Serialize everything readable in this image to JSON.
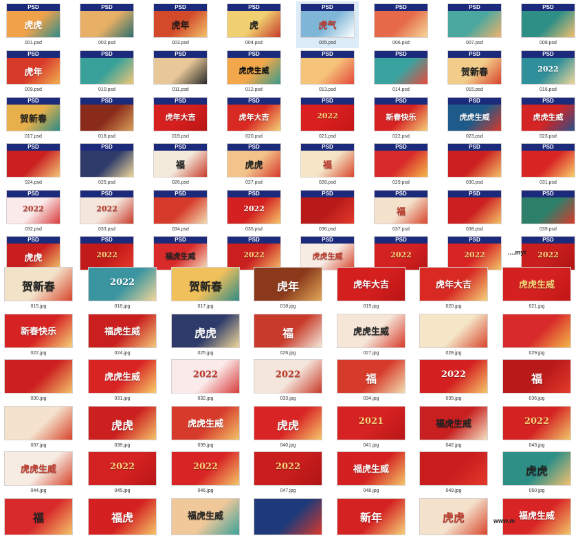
{
  "badge_label": "PSD",
  "watermarks": [
    "….myt",
    "www.m"
  ],
  "top_section": [
    {
      "cap": "001.psd",
      "title": "虎虎",
      "c": "#f0a24a",
      "c2": "#2f8c8c",
      "tc": "#ffffff"
    },
    {
      "cap": "002.psd",
      "title": "",
      "c": "#e8b066",
      "c2": "#2b6e6e",
      "tc": "#ffffff"
    },
    {
      "cap": "003.psd",
      "title": "虎年",
      "c": "#d24a2a",
      "c2": "#f2c36a",
      "tc": "#2b1a1a"
    },
    {
      "cap": "004.psd",
      "title": "虎",
      "c": "#f0d070",
      "c2": "#c73b2a",
      "tc": "#222222"
    },
    {
      "cap": "005.psd",
      "title": "虎气",
      "c": "#7fb6d8",
      "c2": "#ffffff",
      "tc": "#c0392b"
    },
    {
      "cap": "006.psd",
      "title": "",
      "c": "#e66a4a",
      "c2": "#f5d89a",
      "tc": "#ffffff"
    },
    {
      "cap": "007.psd",
      "title": "",
      "c": "#4aa8a0",
      "c2": "#f2b26a",
      "tc": "#ffffff"
    },
    {
      "cap": "008.psd",
      "title": "",
      "c": "#2e8f86",
      "c2": "#f3c070",
      "tc": "#ffffff"
    },
    {
      "cap": "009.psd",
      "title": "虎年",
      "c": "#d83a2a",
      "c2": "#f2b050",
      "tc": "#ffffff"
    },
    {
      "cap": "010.psd",
      "title": "",
      "c": "#3aa19a",
      "c2": "#f0c777",
      "tc": "#ffffff"
    },
    {
      "cap": "011.psd",
      "title": "",
      "c": "#e8c898",
      "c2": "#2a2a2a",
      "tc": "#111111"
    },
    {
      "cap": "012.psd",
      "title": "虎虎生威",
      "c": "#f2a84a",
      "c2": "#3a9a8a",
      "tc": "#111111"
    },
    {
      "cap": "013.psd",
      "title": "",
      "c": "#f6c37a",
      "c2": "#e44a3a",
      "tc": "#ffffff"
    },
    {
      "cap": "014.psd",
      "title": "",
      "c": "#3aa3a0",
      "c2": "#e64a3a",
      "tc": "#ffffff"
    },
    {
      "cap": "015.psd",
      "title": "贺新春",
      "c": "#f2cc8a",
      "c2": "#d8452c",
      "tc": "#222222"
    },
    {
      "cap": "016.psd",
      "title": "2022",
      "c": "#2f8f9a",
      "c2": "#f0d79a",
      "tc": "#ffffff"
    },
    {
      "cap": "017.psd",
      "title": "贺新春",
      "c": "#e8b04a",
      "c2": "#2a8b86",
      "tc": "#222222"
    },
    {
      "cap": "018.psd",
      "title": "",
      "c": "#8a2a1a",
      "c2": "#d8a05a",
      "tc": "#ffffff"
    },
    {
      "cap": "019.psd",
      "title": "虎年大吉",
      "c": "#d61f1f",
      "c2": "#b81414",
      "tc": "#ffffff"
    },
    {
      "cap": "020.psd",
      "title": "虎年大吉",
      "c": "#d82a22",
      "c2": "#f3d27a",
      "tc": "#ffffff"
    },
    {
      "cap": "021.psd",
      "title": "2022",
      "c": "#d91f1f",
      "c2": "#c21616",
      "tc": "#f7d27a"
    },
    {
      "cap": "022.psd",
      "title": "新春快乐",
      "c": "#d62222",
      "c2": "#f5d27a",
      "tc": "#ffffff"
    },
    {
      "cap": "023.psd",
      "title": "虎虎生威",
      "c": "#1e5b8a",
      "c2": "#d8392a",
      "tc": "#ffffff"
    },
    {
      "cap": "023.psd",
      "title": "虎虎生威",
      "c": "#d42424",
      "c2": "#2b4f8a",
      "tc": "#ffffff"
    },
    {
      "cap": "024.psd",
      "title": "",
      "c": "#c91f1f",
      "c2": "#f2c77a",
      "tc": "#ffffff"
    },
    {
      "cap": "025.psd",
      "title": "",
      "c": "#2e3b6a",
      "c2": "#f0d89a",
      "tc": "#ffffff"
    },
    {
      "cap": "026.psd",
      "title": "福",
      "c": "#f3eadb",
      "c2": "#c83a2a",
      "tc": "#222222"
    },
    {
      "cap": "027.psd",
      "title": "虎虎",
      "c": "#f2c38a",
      "c2": "#d83a2a",
      "tc": "#222222"
    },
    {
      "cap": "028.psd",
      "title": "福",
      "c": "#f5e6c8",
      "c2": "#d8452c",
      "tc": "#c0392b"
    },
    {
      "cap": "029.psd",
      "title": "",
      "c": "#d82a2a",
      "c2": "#f3b84a",
      "tc": "#ffffff"
    },
    {
      "cap": "030.psd",
      "title": "",
      "c": "#cc1f1f",
      "c2": "#f2c06a",
      "tc": "#ffffff"
    },
    {
      "cap": "031.psd",
      "title": "",
      "c": "#d92424",
      "c2": "#f7ce6a",
      "tc": "#ffffff"
    },
    {
      "cap": "032.psd",
      "title": "2022",
      "c": "#fbeaea",
      "c2": "#d83a3a",
      "tc": "#c0392b"
    },
    {
      "cap": "033.psd",
      "title": "2022",
      "c": "#f5e6dc",
      "c2": "#c83a2a",
      "tc": "#c0392b"
    },
    {
      "cap": "034.psd",
      "title": "",
      "c": "#d63a2a",
      "c2": "#f2dcb0",
      "tc": "#ffffff"
    },
    {
      "cap": "035.psd",
      "title": "2022",
      "c": "#d42020",
      "c2": "#f5c66a",
      "tc": "#ffffff"
    },
    {
      "cap": "036.psd",
      "title": "",
      "c": "#b81a1a",
      "c2": "#e43a2a",
      "tc": "#ffffff"
    },
    {
      "cap": "037.psd",
      "title": "福",
      "c": "#f4e2cc",
      "c2": "#d8452c",
      "tc": "#c0392b"
    },
    {
      "cap": "038.psd",
      "title": "",
      "c": "#cc2020",
      "c2": "#f4c36a",
      "tc": "#ffffff"
    },
    {
      "cap": "039.psd",
      "title": "",
      "c": "#2e7f6a",
      "c2": "#d83a2a",
      "tc": "#ffffff"
    },
    {
      "cap": "",
      "title": "虎虎",
      "c": "#c81e1e",
      "c2": "#f0c36a",
      "tc": "#ffffff"
    },
    {
      "cap": "",
      "title": "2022",
      "c": "#c21a1a",
      "c2": "#e53a2a",
      "tc": "#f7d27a"
    },
    {
      "cap": "",
      "title": "福虎生威",
      "c": "#d82a2a",
      "c2": "#f4e2c4",
      "tc": "#222222"
    },
    {
      "cap": "",
      "title": "2022",
      "c": "#c91f1f",
      "c2": "#f5c06a",
      "tc": "#f7d27a"
    },
    {
      "cap": "",
      "title": "虎虎生威",
      "c": "#f6ece4",
      "c2": "#d8452c",
      "tc": "#c0392b"
    },
    {
      "cap": "",
      "title": "2022",
      "c": "#d42222",
      "c2": "#b81616",
      "tc": "#f7d27a"
    },
    {
      "cap": "",
      "title": "2022",
      "c": "#d82424",
      "c2": "#f2c66a",
      "tc": "#f7d27a"
    },
    {
      "cap": "",
      "title": "2022",
      "c": "#c81e1e",
      "c2": "#b01414",
      "tc": "#f7d27a"
    }
  ],
  "bottom_section": [
    {
      "cap": "015.jpg",
      "title": "贺新春",
      "c": "#f2e2c8",
      "c2": "#d8452c",
      "tc": "#222222"
    },
    {
      "cap": "016.jpg",
      "title": "2022",
      "c": "#3a95a0",
      "c2": "#f3d79a",
      "tc": "#ffffff"
    },
    {
      "cap": "017.jpg",
      "title": "贺新春",
      "c": "#f0c05a",
      "c2": "#2f8a86",
      "tc": "#222222"
    },
    {
      "cap": "018.jpg",
      "title": "虎年",
      "c": "#8a3a1a",
      "c2": "#e0a85a",
      "tc": "#ffffff"
    },
    {
      "cap": "019.jpg",
      "title": "虎年大吉",
      "c": "#d41f1f",
      "c2": "#b81414",
      "tc": "#ffffff"
    },
    {
      "cap": "020.jpg",
      "title": "虎年大吉",
      "c": "#d82a22",
      "c2": "#f3d27a",
      "tc": "#ffffff"
    },
    {
      "cap": "021.jpg",
      "title": "虎虎生威",
      "c": "#d42020",
      "c2": "#c21616",
      "tc": "#f7d27a"
    },
    {
      "cap": "022.jpg",
      "title": "新春快乐",
      "c": "#d62222",
      "c2": "#f4d27a",
      "tc": "#ffffff"
    },
    {
      "cap": "024.jpg",
      "title": "福虎生威",
      "c": "#c91f1f",
      "c2": "#f2c77a",
      "tc": "#ffffff"
    },
    {
      "cap": "025.jpg",
      "title": "虎虎",
      "c": "#2e3b6a",
      "c2": "#f0d89a",
      "tc": "#ffffff"
    },
    {
      "cap": "026.jpg",
      "title": "福",
      "c": "#c83a2a",
      "c2": "#f3eadb",
      "tc": "#ffffff"
    },
    {
      "cap": "027.jpg",
      "title": "虎虎生威",
      "c": "#f5e6d8",
      "c2": "#d83a2a",
      "tc": "#222222"
    },
    {
      "cap": "028.jpg",
      "title": "",
      "c": "#f5e6c8",
      "c2": "#d8452c",
      "tc": "#c0392b"
    },
    {
      "cap": "029.jpg",
      "title": "",
      "c": "#d82a2a",
      "c2": "#f3b84a",
      "tc": "#ffffff"
    },
    {
      "cap": "030.jpg",
      "title": "",
      "c": "#cc1f1f",
      "c2": "#f2c06a",
      "tc": "#ffffff"
    },
    {
      "cap": "031.jpg",
      "title": "虎虎生威",
      "c": "#d92424",
      "c2": "#f7ce6a",
      "tc": "#ffffff"
    },
    {
      "cap": "032.jpg",
      "title": "2022",
      "c": "#fbeaea",
      "c2": "#d83a3a",
      "tc": "#c0392b"
    },
    {
      "cap": "033.jpg",
      "title": "2022",
      "c": "#f5e6dc",
      "c2": "#c83a2a",
      "tc": "#c0392b"
    },
    {
      "cap": "034.jpg",
      "title": "福",
      "c": "#d63a2a",
      "c2": "#f2dcb0",
      "tc": "#ffffff"
    },
    {
      "cap": "035.jpg",
      "title": "2022",
      "c": "#d42020",
      "c2": "#f5c66a",
      "tc": "#ffffff"
    },
    {
      "cap": "036.jpg",
      "title": "福",
      "c": "#b81a1a",
      "c2": "#e43a2a",
      "tc": "#ffffff"
    },
    {
      "cap": "037.jpg",
      "title": "",
      "c": "#f4e2cc",
      "c2": "#d8452c",
      "tc": "#c0392b"
    },
    {
      "cap": "038.jpg",
      "title": "虎虎",
      "c": "#cc2020",
      "c2": "#f4c36a",
      "tc": "#ffffff"
    },
    {
      "cap": "039.jpg",
      "title": "虎虎生威",
      "c": "#d63a2a",
      "c2": "#f2c36a",
      "tc": "#ffffff"
    },
    {
      "cap": "040.jpg",
      "title": "虎虎",
      "c": "#d82424",
      "c2": "#f5c66a",
      "tc": "#ffffff"
    },
    {
      "cap": "041.jpg",
      "title": "2021",
      "c": "#d62222",
      "c2": "#b81616",
      "tc": "#f7d27a"
    },
    {
      "cap": "042.jpg",
      "title": "福虎生威",
      "c": "#c82020",
      "c2": "#f4e2c4",
      "tc": "#222222"
    },
    {
      "cap": "043.jpg",
      "title": "2022",
      "c": "#d42222",
      "c2": "#f2c66a",
      "tc": "#f7d27a"
    },
    {
      "cap": "044.jpg",
      "title": "虎虎生威",
      "c": "#f6ece4",
      "c2": "#d8452c",
      "tc": "#c0392b"
    },
    {
      "cap": "045.jpg",
      "title": "2022",
      "c": "#d42222",
      "c2": "#b81616",
      "tc": "#f7d27a"
    },
    {
      "cap": "046.jpg",
      "title": "2022",
      "c": "#d82424",
      "c2": "#f2c66a",
      "tc": "#f7d27a"
    },
    {
      "cap": "047.jpg",
      "title": "2022",
      "c": "#c81e1e",
      "c2": "#b01414",
      "tc": "#f7d27a"
    },
    {
      "cap": "048.jpg",
      "title": "福虎生威",
      "c": "#d42020",
      "c2": "#f2c66a",
      "tc": "#ffffff"
    },
    {
      "cap": "049.jpg",
      "title": "",
      "c": "#c81e1e",
      "c2": "#e43a2a",
      "tc": "#ffffff"
    },
    {
      "cap": "050.jpg",
      "title": "虎虎",
      "c": "#2e8f86",
      "c2": "#f3c070",
      "tc": "#222222"
    },
    {
      "cap": "",
      "title": "福",
      "c": "#d82a2a",
      "c2": "#f4c36a",
      "tc": "#222222"
    },
    {
      "cap": "",
      "title": "福虎",
      "c": "#d42020",
      "c2": "#f5c66a",
      "tc": "#ffffff"
    },
    {
      "cap": "",
      "title": "福虎生威",
      "c": "#f0c89a",
      "c2": "#3aa19a",
      "tc": "#222222"
    },
    {
      "cap": "",
      "title": "",
      "c": "#1e3a7a",
      "c2": "#d8392a",
      "tc": "#ffffff"
    },
    {
      "cap": "",
      "title": "新年",
      "c": "#d42222",
      "c2": "#f4d27a",
      "tc": "#ffffff"
    },
    {
      "cap": "",
      "title": "虎虎",
      "c": "#f4e2cc",
      "c2": "#d8452c",
      "tc": "#c0392b"
    },
    {
      "cap": "",
      "title": "福虎生威",
      "c": "#d82424",
      "c2": "#f2c66a",
      "tc": "#ffffff"
    }
  ]
}
